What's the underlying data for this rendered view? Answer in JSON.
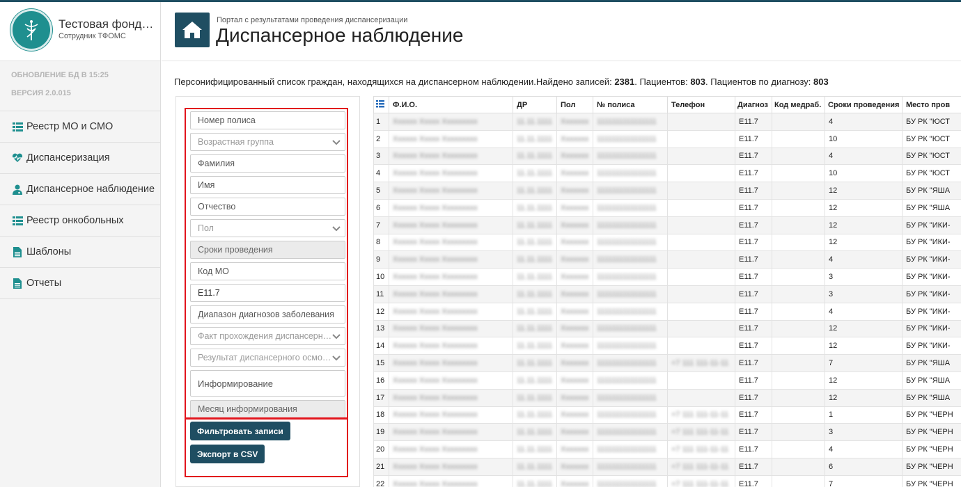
{
  "user": {
    "name": "Тестовая фонд…",
    "role": "Сотрудник ТФОМС"
  },
  "meta": {
    "db_update": "ОБНОВЛЕНИЕ БД В 15:25",
    "version": "ВЕРСИЯ 2.0.015"
  },
  "nav": [
    {
      "label": "Реестр МО и СМО",
      "icon": "list-icon"
    },
    {
      "label": "Диспансеризация",
      "icon": "heartbeat-icon"
    },
    {
      "label": "Диспансерное наблюдение",
      "icon": "user-md-icon"
    },
    {
      "label": "Реестр онкобольных",
      "icon": "list-icon"
    },
    {
      "label": "Шаблоны",
      "icon": "file-icon"
    },
    {
      "label": "Отчеты",
      "icon": "file-icon"
    }
  ],
  "header": {
    "breadcrumb": "Портал с результатами проведения диспансеризации",
    "title": "Диспансерное наблюдение"
  },
  "summary": {
    "text": "Персонифицированный список граждан, находящихся на диспансерном наблюдении.Найдено записей: ",
    "found": "2381",
    "patients_label": ". Пациентов: ",
    "patients": "803",
    "by_diag_label": ". Пациентов по диагнозу: ",
    "by_diag": "803"
  },
  "filters": {
    "policy": "Номер полиса",
    "age_group": "Возрастная группа",
    "last_name": "Фамилия",
    "first_name": "Имя",
    "patronymic": "Отчество",
    "sex": "Пол",
    "terms": "Сроки проведения",
    "mo_code": "Код МО",
    "diagnosis_value": "E11.7",
    "diag_range": "Диапазон диагнозов заболевания",
    "fact": "Факт прохождения диспансерн…",
    "result": "Результат диспансерного осмо…",
    "informing": "Информирование",
    "inform_month": "Месяц информирования",
    "filter_btn": "Фильтровать записи",
    "export_btn": "Экспорт в CSV"
  },
  "table": {
    "columns": [
      "Ф.И.О.",
      "ДР",
      "Пол",
      "№ полиса",
      "Телефон",
      "Диагноз",
      "Код медраб.",
      "Сроки проведения",
      "Место пров"
    ],
    "rows": [
      {
        "n": "1",
        "diag": "E11.7",
        "term": "4",
        "place": "БУ РК \"ЮСТ"
      },
      {
        "n": "2",
        "diag": "E11.7",
        "term": "10",
        "place": "БУ РК \"ЮСТ"
      },
      {
        "n": "3",
        "diag": "E11.7",
        "term": "4",
        "place": "БУ РК \"ЮСТ"
      },
      {
        "n": "4",
        "diag": "E11.7",
        "term": "10",
        "place": "БУ РК \"ЮСТ"
      },
      {
        "n": "5",
        "diag": "E11.7",
        "term": "12",
        "place": "БУ РК \"ЯША"
      },
      {
        "n": "6",
        "diag": "E11.7",
        "term": "12",
        "place": "БУ РК \"ЯША"
      },
      {
        "n": "7",
        "diag": "E11.7",
        "term": "12",
        "place": "БУ РК \"ИКИ-"
      },
      {
        "n": "8",
        "diag": "E11.7",
        "term": "12",
        "place": "БУ РК \"ИКИ-"
      },
      {
        "n": "9",
        "diag": "E11.7",
        "term": "4",
        "place": "БУ РК \"ИКИ-"
      },
      {
        "n": "10",
        "diag": "E11.7",
        "term": "3",
        "place": "БУ РК \"ИКИ-"
      },
      {
        "n": "11",
        "diag": "E11.7",
        "term": "3",
        "place": "БУ РК \"ИКИ-"
      },
      {
        "n": "12",
        "diag": "E11.7",
        "term": "4",
        "place": "БУ РК \"ИКИ-"
      },
      {
        "n": "13",
        "diag": "E11.7",
        "term": "12",
        "place": "БУ РК \"ИКИ-"
      },
      {
        "n": "14",
        "diag": "E11.7",
        "term": "12",
        "place": "БУ РК \"ИКИ-"
      },
      {
        "n": "15",
        "diag": "E11.7",
        "term": "7",
        "place": "БУ РК \"ЯША"
      },
      {
        "n": "16",
        "diag": "E11.7",
        "term": "12",
        "place": "БУ РК \"ЯША"
      },
      {
        "n": "17",
        "diag": "E11.7",
        "term": "12",
        "place": "БУ РК \"ЯША"
      },
      {
        "n": "18",
        "diag": "E11.7",
        "term": "1",
        "place": "БУ РК \"ЧЕРН"
      },
      {
        "n": "19",
        "diag": "E11.7",
        "term": "3",
        "place": "БУ РК \"ЧЕРН"
      },
      {
        "n": "20",
        "diag": "E11.7",
        "term": "4",
        "place": "БУ РК \"ЧЕРН"
      },
      {
        "n": "21",
        "diag": "E11.7",
        "term": "6",
        "place": "БУ РК \"ЧЕРН"
      },
      {
        "n": "22",
        "diag": "E11.7",
        "term": "7",
        "place": "БУ РК \"ЧЕРН"
      }
    ]
  },
  "colors": {
    "accent": "#1f4e62",
    "avatar": "#1f8f8f",
    "highlight_box": "#e2141c"
  }
}
